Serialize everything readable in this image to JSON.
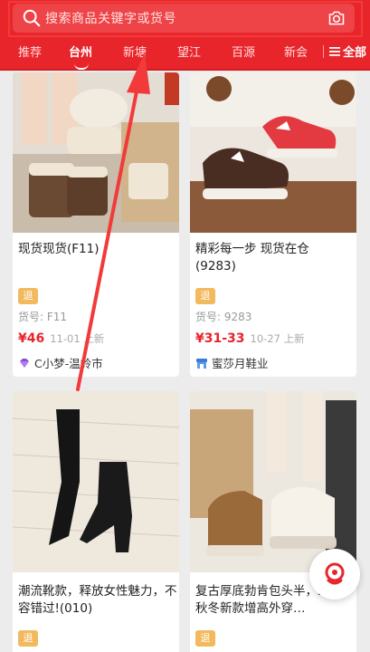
{
  "search": {
    "placeholder": "搜索商品关键字或货号"
  },
  "tabs": [
    {
      "label": "推荐",
      "active": false
    },
    {
      "label": "台州",
      "active": true
    },
    {
      "label": "新塘",
      "active": false
    },
    {
      "label": "望江",
      "active": false
    },
    {
      "label": "百源",
      "active": false
    },
    {
      "label": "新会",
      "active": false
    }
  ],
  "all_tabs_label": "全部",
  "products": [
    {
      "title": "现货现货(F11)",
      "badge": "退",
      "sku": "货号: F11",
      "price": "¥46",
      "date": "11-01 上新",
      "shop": "C小梦-温岭市",
      "shop_icon": "diamond-icon"
    },
    {
      "title": "精彩每一步 现货在仓\n(9283)",
      "badge": "退",
      "sku": "货号: 9283",
      "price": "¥31-33",
      "date": "10-27 上新",
      "shop": "蜜莎月鞋业",
      "shop_icon": "store-icon"
    },
    {
      "title": "潮流靴款，释放女性魅力，不容错过!(010)",
      "badge": "退"
    },
    {
      "title": "复古厚底勃肯包头半，2025秋冬新款增高外穿…",
      "badge": "退"
    }
  ],
  "colors": {
    "brand_red": "#e8252b",
    "price_red": "#e8252b",
    "badge_orange": "#f3b95f"
  }
}
